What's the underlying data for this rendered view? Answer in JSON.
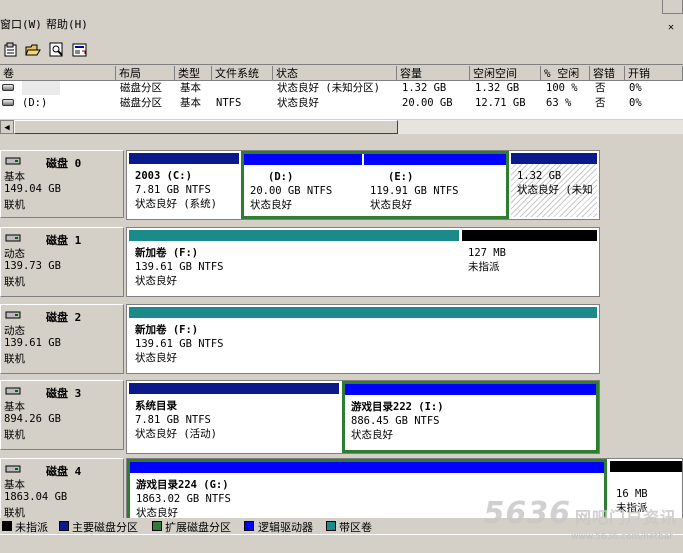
{
  "menu": {
    "window": "窗口(W)",
    "help": "帮助(H)"
  },
  "toolbar": [
    "properties-icon",
    "open-folder-icon",
    "find-icon",
    "refresh-icon"
  ],
  "columns": [
    "卷",
    "布局",
    "类型",
    "文件系统",
    "状态",
    "容量",
    "空闲空间",
    "% 空闲",
    "容错",
    "开销"
  ],
  "volumes": [
    {
      "name": "",
      "layout": "磁盘分区",
      "type": "基本",
      "fs": "",
      "status": "状态良好 (未知分区)",
      "capacity": "1.32 GB",
      "free": "1.32 GB",
      "pct": "100 %",
      "ft": "否",
      "overhead": "0%"
    },
    {
      "name": "(D:)",
      "layout": "磁盘分区",
      "type": "基本",
      "fs": "NTFS",
      "status": "状态良好",
      "capacity": "20.00 GB",
      "free": "12.71 GB",
      "pct": "63 %",
      "ft": "否",
      "overhead": "0%"
    }
  ],
  "disks": [
    {
      "name": "磁盘 0",
      "type": "基本",
      "size": "149.04 GB",
      "status": "联机",
      "parts": [
        {
          "title": "2003  (C:)",
          "size": "7.81 GB NTFS",
          "status": "状态良好 (系统)",
          "color": "#0a1a8a"
        },
        {
          "title": "(D:)",
          "size": "20.00 GB NTFS",
          "status": "状态良好",
          "color": "#0000ff"
        },
        {
          "title": "(E:)",
          "size": "119.91 GB NTFS",
          "status": "状态良好",
          "color": "#0000ff"
        },
        {
          "title": "",
          "size": "1.32 GB",
          "status": "状态良好 (未知",
          "color": "#0a1a8a"
        }
      ]
    },
    {
      "name": "磁盘 1",
      "type": "动态",
      "size": "139.73 GB",
      "status": "联机",
      "parts": [
        {
          "title": "新加卷  (F:)",
          "size": "139.61 GB NTFS",
          "status": "状态良好",
          "color": "#1a8a8a"
        },
        {
          "title": "",
          "size": "127 MB",
          "status": "未指派",
          "color": "#000000"
        }
      ]
    },
    {
      "name": "磁盘 2",
      "type": "动态",
      "size": "139.61 GB",
      "status": "联机",
      "parts": [
        {
          "title": "新加卷  (F:)",
          "size": "139.61 GB NTFS",
          "status": "状态良好",
          "color": "#1a8a8a"
        }
      ]
    },
    {
      "name": "磁盘 3",
      "type": "基本",
      "size": "894.26 GB",
      "status": "联机",
      "parts": [
        {
          "title": "系统目录",
          "size": "7.81 GB NTFS",
          "status": "状态良好 (活动)",
          "color": "#0a1a8a"
        },
        {
          "title": "游戏目录222  (I:)",
          "size": "886.45 GB NTFS",
          "status": "状态良好",
          "color": "#0000ff"
        }
      ]
    },
    {
      "name": "磁盘 4",
      "type": "基本",
      "size": "1863.04 GB",
      "status": "联机",
      "parts": [
        {
          "title": "游戏目录224  (G:)",
          "size": "1863.02 GB NTFS",
          "status": "状态良好",
          "color": "#0000ff"
        },
        {
          "title": "",
          "size": "16 MB",
          "status": "未指派",
          "color": "#000000"
        }
      ]
    }
  ],
  "legend": [
    {
      "label": "未指派",
      "color": "#000000"
    },
    {
      "label": "主要磁盘分区",
      "color": "#0a1a8a"
    },
    {
      "label": "扩展磁盘分区",
      "color": "#2e7d32"
    },
    {
      "label": "逻辑驱动器",
      "color": "#0000ff"
    },
    {
      "label": "带区卷",
      "color": "#1a8a8a"
    }
  ],
  "watermark": {
    "main": "5636",
    "sub": "网吧门户资讯",
    "url": "www.5636.com/netbar"
  }
}
